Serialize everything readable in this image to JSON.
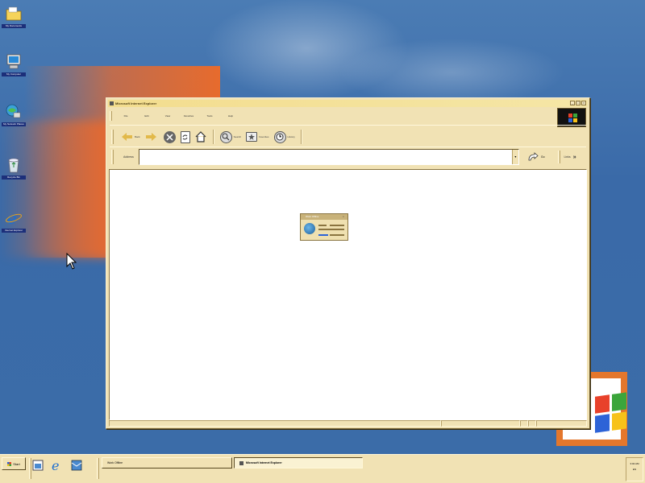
{
  "desktop": {
    "icons": [
      {
        "label": "My Documents",
        "icon": "folder-icon"
      },
      {
        "label": "My Computer",
        "icon": "computer-icon"
      },
      {
        "label": "My Network Places",
        "icon": "network-icon"
      },
      {
        "label": "Recycle Bin",
        "icon": "recycle-bin-icon"
      },
      {
        "label": "Internet Explorer",
        "icon": "ie-icon"
      }
    ],
    "colors": {
      "background": "#3c6ea8",
      "accent_orange": "#e76b2d"
    }
  },
  "ie_window": {
    "title": "Microsoft Internet Explorer",
    "menu": [
      "File",
      "Edit",
      "View",
      "Favorites",
      "Tools",
      "Help"
    ],
    "toolbar": {
      "back_label": "Back",
      "forward_label": "",
      "stop_label": "",
      "refresh_label": "",
      "home_label": "",
      "search_label": "Search",
      "favorites_label": "Favorites",
      "history_label": "History"
    },
    "address": {
      "label": "Address",
      "value": "",
      "go_label": "Go",
      "links_label": "Links",
      "chevron": "»"
    },
    "work_offline": {
      "title": "Work Offline",
      "close": "×"
    },
    "window_buttons": {
      "minimize": "_",
      "maximize": "□",
      "close": "×"
    }
  },
  "taskbar": {
    "start_label": "Start",
    "tasks": [
      {
        "label": "Work Offline",
        "active": false
      },
      {
        "label": "Microsoft Internet Explorer",
        "active": true
      }
    ],
    "clock": "3:02 AM",
    "tray_extra": "EN"
  }
}
